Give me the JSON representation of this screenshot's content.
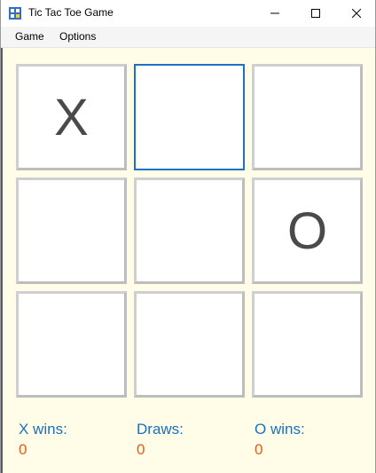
{
  "window": {
    "title": "Tic Tac Toe Game",
    "controls": {
      "minimize": "minimize",
      "maximize": "maximize",
      "close": "close"
    }
  },
  "menu": {
    "items": [
      "Game",
      "Options"
    ]
  },
  "board": {
    "cells": [
      "X",
      "",
      "",
      "",
      "",
      "O",
      "",
      "",
      ""
    ],
    "focused_index": 1
  },
  "stats": {
    "x_label": "X wins:",
    "x_value": "0",
    "draws_label": "Draws:",
    "draws_value": "0",
    "o_label": "O wins:",
    "o_value": "0"
  },
  "colors": {
    "background": "#fffde8",
    "label": "#1a6fc0",
    "value": "#e65c14",
    "focus_border": "#1a73c8"
  }
}
